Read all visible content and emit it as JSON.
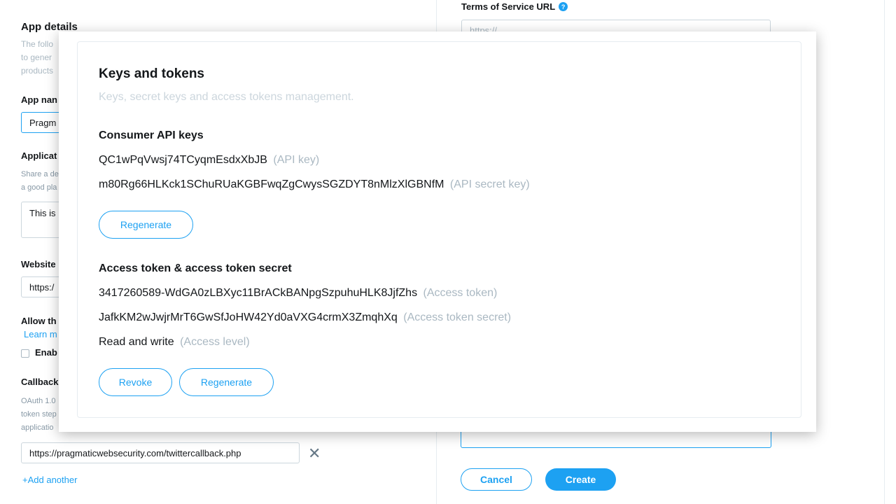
{
  "background": {
    "app_details": {
      "title": "App details",
      "desc_lines": [
        "The follo",
        "to gener",
        "products"
      ]
    },
    "app_name": {
      "label": "App nan",
      "value": "Pragm"
    },
    "application_description": {
      "label": "Applicat",
      "desc_lines": [
        "Share a de",
        "a good pla"
      ],
      "value": "This is"
    },
    "website": {
      "label": "Website",
      "value": "https:/"
    },
    "allow": {
      "label": "Allow th",
      "learn_more": "Learn m",
      "enable_label": "Enab"
    },
    "callback": {
      "label": "Callback",
      "desc_lines": [
        "OAuth 1.0",
        "token step",
        "applicatio"
      ],
      "value": "https://pragmaticwebsecurity.com/twittercallback.php",
      "add_another": "Add another"
    },
    "terms": {
      "label": "Terms of Service URL",
      "placeholder": "https://"
    },
    "actions": {
      "cancel": "Cancel",
      "create": "Create"
    }
  },
  "modal": {
    "title": "Keys and tokens",
    "subtitle": "Keys, secret keys and access tokens management.",
    "consumer": {
      "heading": "Consumer API keys",
      "api_key": "QC1wPqVwsj74TCyqmEsdxXbJB",
      "api_key_hint": "(API key)",
      "api_secret": "m80Rg66HLKck1SChuRUaKGBFwqZgCwysSGZDYT8nMlzXlGBNfM",
      "api_secret_hint": "(API secret key)",
      "regenerate": "Regenerate"
    },
    "access": {
      "heading": "Access token & access token secret",
      "token": "3417260589-WdGA0zLBXyc11BrACkBANpgSzpuhuHLK8JjfZhs",
      "token_hint": "(Access token)",
      "secret": "JafkKM2wJwjrMrT6GwSfJoHW42Yd0aVXG4crmX3ZmqhXq",
      "secret_hint": "(Access token secret)",
      "level": "Read and write",
      "level_hint": "(Access level)",
      "revoke": "Revoke",
      "regenerate": "Regenerate"
    }
  },
  "colors": {
    "accent": "#1da1f2",
    "text": "#14171a",
    "muted": "#aab8c2"
  }
}
